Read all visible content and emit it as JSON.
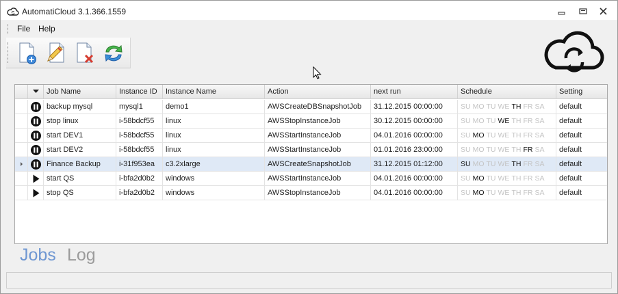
{
  "window": {
    "title": "AutomatiCloud 3.1.366.1559"
  },
  "menu": [
    {
      "label": "File"
    },
    {
      "label": "Help"
    }
  ],
  "toolbar": {
    "buttons": [
      {
        "icon": "new-document-icon",
        "name": "New job"
      },
      {
        "icon": "edit-document-icon",
        "name": "Edit job"
      },
      {
        "icon": "delete-document-icon",
        "name": "Delete job"
      },
      {
        "icon": "refresh-icon",
        "name": "Refresh"
      }
    ]
  },
  "grid": {
    "columns": [
      "Job Name",
      "Instance ID",
      "Instance Name",
      "Action",
      "next run",
      "Schedule",
      "Setting"
    ],
    "day_labels": [
      "SU",
      "MO",
      "TU",
      "WE",
      "TH",
      "FR",
      "SA"
    ],
    "rows": [
      {
        "status": "pause",
        "job": "backup mysql",
        "instance_id": "mysql1",
        "instance_name": "demo1",
        "action": "AWSCreateDBSnapshotJob",
        "next_run": "31.12.2015 00:00:00",
        "days_on": [
          "TH"
        ],
        "setting": "default"
      },
      {
        "status": "pause",
        "job": "stop linux",
        "instance_id": "i-58bdcf55",
        "instance_name": "linux",
        "action": "AWSStopInstanceJob",
        "next_run": "30.12.2015 00:00:00",
        "days_on": [
          "WE"
        ],
        "setting": "default"
      },
      {
        "status": "pause",
        "job": "start DEV1",
        "instance_id": "i-58bdcf55",
        "instance_name": "linux",
        "action": "AWSStartInstanceJob",
        "next_run": "04.01.2016 00:00:00",
        "days_on": [
          "MO"
        ],
        "setting": "default"
      },
      {
        "status": "pause",
        "job": "start DEV2",
        "instance_id": "i-58bdcf55",
        "instance_name": "linux",
        "action": "AWSStartInstanceJob",
        "next_run": "01.01.2016 23:00:00",
        "days_on": [
          "FR"
        ],
        "setting": "default"
      },
      {
        "status": "pause",
        "job": "Finance Backup",
        "instance_id": "i-31f953ea",
        "instance_name": "c3.2xlarge",
        "action": "AWSCreateSnapshotJob",
        "next_run": "31.12.2015 01:12:00",
        "days_on": [
          "SU",
          "TH"
        ],
        "setting": "default",
        "selected": true
      },
      {
        "status": "play",
        "job": "start QS",
        "instance_id": "i-bfa2d0b2",
        "instance_name": "windows",
        "action": "AWSStartInstanceJob",
        "next_run": "04.01.2016 00:00:00",
        "days_on": [
          "MO"
        ],
        "setting": "default"
      },
      {
        "status": "play",
        "job": "stop QS",
        "instance_id": "i-bfa2d0b2",
        "instance_name": "windows",
        "action": "AWSStopInstanceJob",
        "next_run": "04.01.2016 00:00:00",
        "days_on": [
          "MO"
        ],
        "setting": "default"
      }
    ]
  },
  "tabs": [
    {
      "label": "Jobs",
      "active": true
    },
    {
      "label": "Log",
      "active": false
    }
  ],
  "colors": {
    "active_tab": "#6f97d2",
    "inactive_tab": "#9b9b9b",
    "selected_row": "#dfe9f6",
    "day_off": "#c4c4c4",
    "day_on": "#111111"
  }
}
